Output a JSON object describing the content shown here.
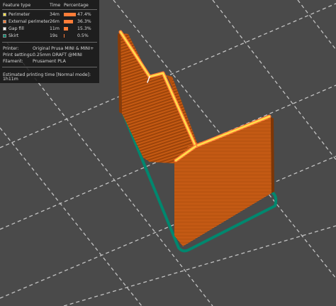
{
  "legend": {
    "headers": {
      "feature": "Feature type",
      "time": "Time",
      "percentage": "Percentage"
    },
    "rows": [
      {
        "name": "Perimeter",
        "time": "34m",
        "percent": "47.4%",
        "fraction": 0.474,
        "color": "#ffe14b"
      },
      {
        "name": "External perimeter",
        "time": "26m",
        "percent": "36.3%",
        "fraction": 0.363,
        "color": "#ff7d38"
      },
      {
        "name": "Gap fill",
        "time": "11m",
        "percent": "15.3%",
        "fraction": 0.153,
        "color": "#ffffff"
      },
      {
        "name": "Skirt",
        "time": "19s",
        "percent": "0.5%",
        "fraction": 0.005,
        "color": "#00876e"
      }
    ],
    "printer_label": "Printer:",
    "printer_value": "Original Prusa MINI & MINI+",
    "print_settings_label": "Print settings:",
    "print_settings_value": "0.25mm DRAFT @MINI",
    "filament_label": "Filament:",
    "filament_value": "Prusament PLA",
    "estimated_time": "Estimated printing time [Normal mode]:  1h11m"
  },
  "colors": {
    "background": "#4a4a4a",
    "grid": "#d8d8d8",
    "model": "#c2580f",
    "model_top": "#ffe14b",
    "skirt": "#00876e"
  }
}
